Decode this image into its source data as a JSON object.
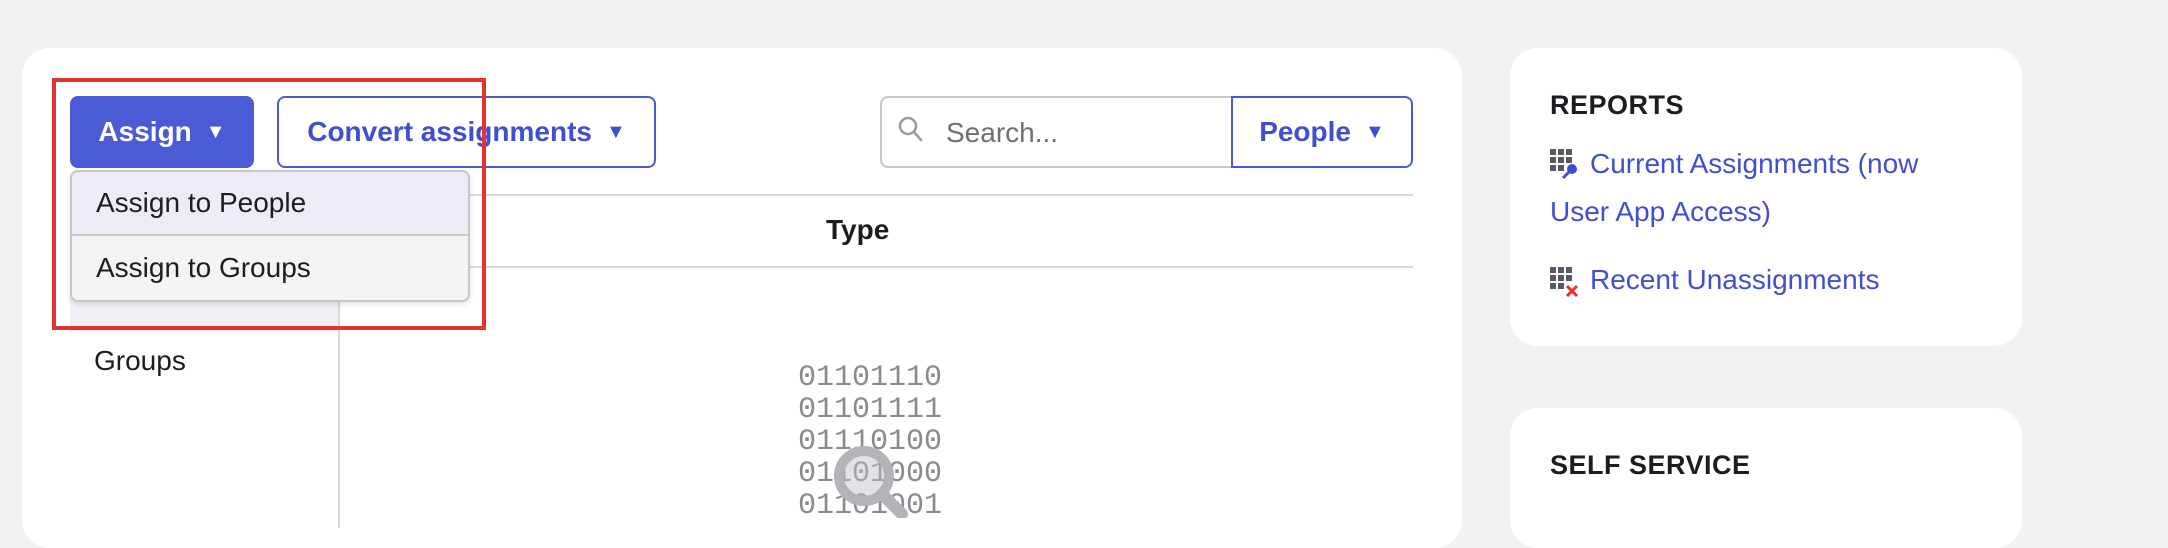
{
  "toolbar": {
    "assign_label": "Assign",
    "convert_label": "Convert assignments",
    "caret": "▼",
    "search_placeholder": "Search...",
    "filter_label": "People"
  },
  "dropdown": {
    "items": [
      {
        "label": "Assign to People"
      },
      {
        "label": "Assign to Groups"
      }
    ]
  },
  "table": {
    "type_header": "Type"
  },
  "sidebar_nav": {
    "groups_label": "Groups"
  },
  "empty_state": {
    "binary_lines": [
      "01101110",
      "01101111",
      "01110100",
      "01101000",
      "01101001"
    ]
  },
  "reports": {
    "title": "REPORTS",
    "links": [
      {
        "label": "Current Assignments (now User App Access)",
        "line1": "Current Assignments (now",
        "line2": "User App Access)",
        "icon": "grid-key-icon"
      },
      {
        "label": "Recent Unassignments",
        "icon": "grid-x-icon"
      }
    ]
  },
  "self_service": {
    "title": "SELF SERVICE"
  },
  "colors": {
    "accent": "#4b5bd6",
    "link": "#3f4fd0",
    "highlight": "#e0342c",
    "background": "#f2f2f2"
  }
}
